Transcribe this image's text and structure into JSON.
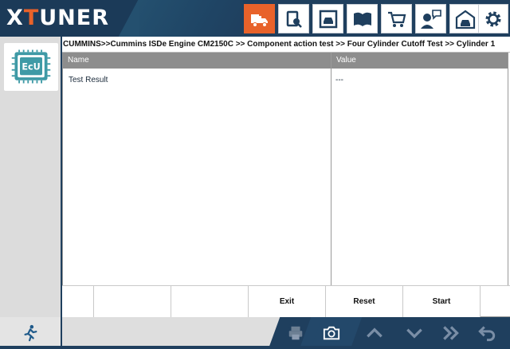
{
  "header": {
    "logo_left": "X",
    "logo_accent": "T",
    "logo_right": "UNER",
    "toolbar": [
      {
        "name": "diagnosis-truck-icon",
        "active": true
      },
      {
        "name": "special-function-icon",
        "active": false
      },
      {
        "name": "vehicle-info-icon",
        "active": false
      },
      {
        "name": "manual-book-icon",
        "active": false
      },
      {
        "name": "shop-cart-icon",
        "active": false
      },
      {
        "name": "feedback-user-icon",
        "active": false
      },
      {
        "name": "garage-car-icon",
        "active": false
      },
      {
        "name": "settings-gear-icon",
        "active": false
      }
    ],
    "accent_color": "#e8622a",
    "bar_color": "#1f3f5e"
  },
  "sidebar": {
    "ecu_label": "EcU"
  },
  "main": {
    "breadcrumb": "CUMMINS>>Cummins ISDe Engine CM2150C >> Component action test >> Four Cylinder Cutoff Test >> Cylinder 1",
    "table": {
      "headers": [
        "Name",
        "Value"
      ],
      "rows": [
        {
          "name": "Test Result",
          "value": "---"
        }
      ]
    },
    "buttons": [
      "",
      "",
      "",
      "Exit",
      "Reset",
      "Start"
    ]
  },
  "footer": {
    "exit_icon": "running-man-icon",
    "icons": [
      "print-icon",
      "camera-icon",
      "chevron-up-icon",
      "chevron-down-icon",
      "double-chevron-right-icon",
      "back-arrow-icon"
    ]
  }
}
